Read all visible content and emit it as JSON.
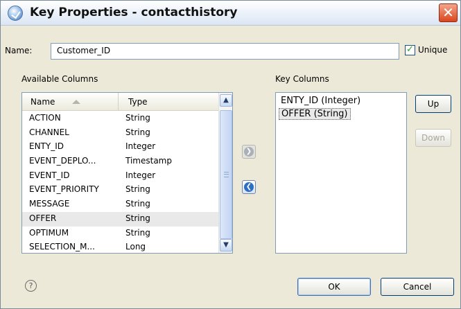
{
  "window": {
    "title": "Key Properties - contacthistory",
    "close_glyph": "✕"
  },
  "name_field": {
    "label": "Name:",
    "value": "Customer_ID"
  },
  "unique": {
    "label": "Unique",
    "checked": true,
    "check_glyph": "✓"
  },
  "available": {
    "title": "Available Columns",
    "headers": {
      "name": "Name",
      "type": "Type"
    },
    "rows": [
      {
        "name": "ACTION",
        "type": "String"
      },
      {
        "name": "CHANNEL",
        "type": "String"
      },
      {
        "name": "ENTY_ID",
        "type": "Integer"
      },
      {
        "name": "EVENT_DEPLO...",
        "type": "Timestamp"
      },
      {
        "name": "EVENT_ID",
        "type": "Integer"
      },
      {
        "name": "EVENT_PRIORITY",
        "type": "String"
      },
      {
        "name": "MESSAGE",
        "type": "String"
      },
      {
        "name": "OFFER",
        "type": "String",
        "selected": true
      },
      {
        "name": "OPTIMUM",
        "type": "String"
      },
      {
        "name": "SELECTION_M...",
        "type": "Long"
      }
    ],
    "scroll_up_glyph": "▲",
    "scroll_down_glyph": "▼"
  },
  "move_buttons": {
    "add_glyph": "❯",
    "remove_glyph": "❮"
  },
  "key_columns": {
    "title": "Key Columns",
    "items": [
      {
        "label": "ENTY_ID (Integer)"
      },
      {
        "label": "OFFER (String)",
        "selected": true
      }
    ]
  },
  "buttons": {
    "up": "Up",
    "down": "Down",
    "ok": "OK",
    "cancel": "Cancel"
  },
  "help": {
    "glyph": "?"
  },
  "colors": {
    "accent": "#2d6fc2",
    "dialog_bg": "#ece9d8",
    "close_red": "#d9451e"
  }
}
